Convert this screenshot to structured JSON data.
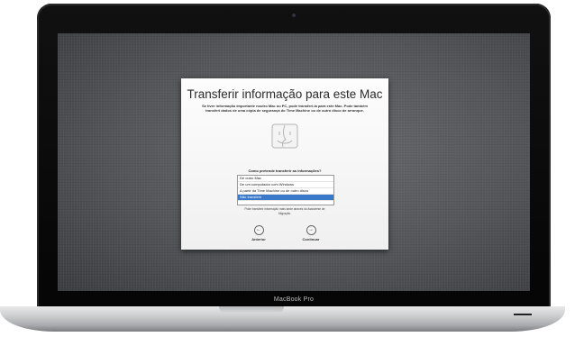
{
  "device": {
    "brand": "MacBook Pro"
  },
  "dialog": {
    "title": "Transferir informação para este Mac",
    "subtitle": "Se tiver informação importante noutro Mac ou PC, pode transferi-la para este Mac. Pode também transferi dados de uma cópia de segurança do Time Machine ou de outro disco de arranque.",
    "question": "Como pretende transferir as informações?",
    "options": [
      {
        "label": "De outro Mac",
        "selected": false
      },
      {
        "label": "De um computador com Windows",
        "selected": false
      },
      {
        "label": "A partir da Time Machine ou de outro disco",
        "selected": false
      },
      {
        "label": "Não transferir",
        "selected": true
      }
    ],
    "note": "Pode transferir informação mais tarde através do Assistente de Migração.",
    "back_label": "Anterior",
    "continue_label": "Continuar",
    "icon": "finder-icon"
  },
  "colors": {
    "selection": "#3a78c9",
    "bezel": "#0a0a0a"
  }
}
